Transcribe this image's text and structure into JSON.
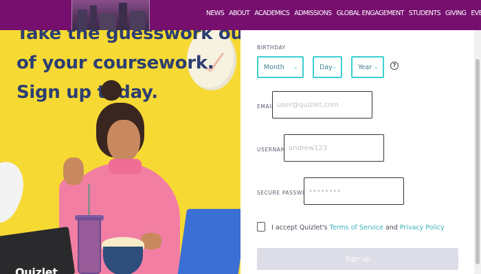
{
  "promo": {
    "heading_line1": "Take the guesswork out",
    "heading_line2": "of your coursework.",
    "heading_line3": "Sign up today.",
    "brand": "Quizlet"
  },
  "navbar": {
    "background": "#760f6e",
    "links": [
      "NEWS",
      "ABOUT",
      "ACADEMICS",
      "ADMISSIONS",
      "GLOBAL ENGAGEMENT",
      "STUDENTS",
      "GIVING",
      "EVENTS"
    ]
  },
  "form": {
    "birthday": {
      "label": "BIRTHDAY",
      "month": "Month",
      "day": "Day",
      "year": "Year",
      "help_icon": "question-circle-icon"
    },
    "email": {
      "label": "EMAIL",
      "placeholder": "user@quizlet.com"
    },
    "username": {
      "label": "USERNAME",
      "placeholder": "andrew123"
    },
    "password": {
      "label": "SECURE PASSWORD",
      "placeholder": "••••••••"
    },
    "terms": {
      "prefix": "I accept Quizlet's ",
      "tos": "Terms of Service",
      "and": " and ",
      "privacy": "Privacy Policy"
    },
    "submit": "Sign up",
    "accent": "#3ccfcf"
  }
}
